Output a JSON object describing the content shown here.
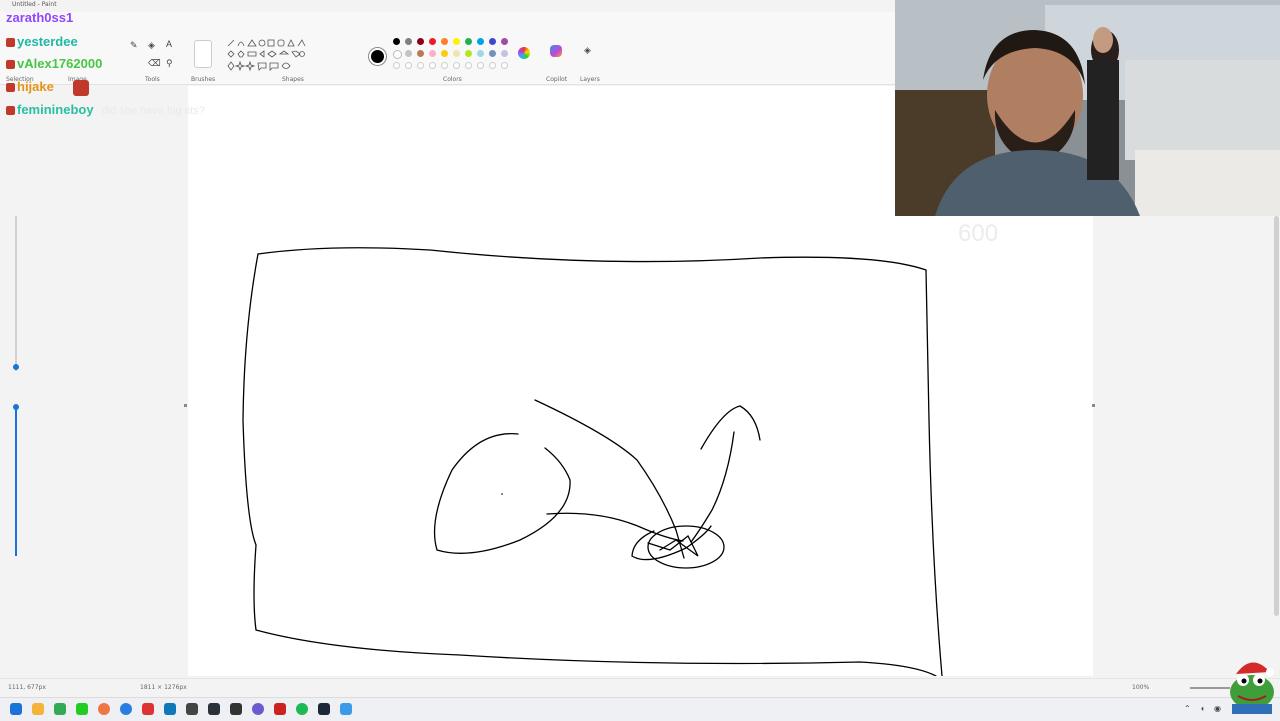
{
  "window": {
    "title": "Untitled - Paint"
  },
  "ribbon": {
    "groups": [
      {
        "label": "Selection"
      },
      {
        "label": "Image"
      },
      {
        "label": "Tools"
      },
      {
        "label": "Brushes"
      },
      {
        "label": "Shapes"
      },
      {
        "label": "Colors"
      },
      {
        "label": "Copilot"
      },
      {
        "label": "Layers"
      }
    ],
    "colors": [
      "#000000",
      "#7f7f7f",
      "#880015",
      "#ed1c24",
      "#ff7f27",
      "#fff200",
      "#22b14c",
      "#00a2e8",
      "#3f48cc",
      "#a349a4",
      "#ffffff",
      "#c3c3c3",
      "#b97a57",
      "#ffaec9",
      "#ffc90e",
      "#efe4b0",
      "#b5e61d",
      "#99d9ea",
      "#7092be",
      "#c8bfe7"
    ],
    "current_color": "#000000"
  },
  "chat": [
    {
      "user": "zarath0ss1",
      "color": "#9146ff",
      "message": ""
    },
    {
      "user": "yesterdee",
      "color": "#1fb8a5",
      "message": ""
    },
    {
      "user": "vAlex1762000",
      "color": "#44c743",
      "message": ""
    },
    {
      "user": "hijake",
      "color": "#e69317",
      "message": ""
    },
    {
      "user": "feminineboy",
      "color": "#28c0a0",
      "message": "did she have big tits?"
    }
  ],
  "overlay": {
    "text": "600"
  },
  "statusbar": {
    "cursor": "1111, 677px",
    "canvas_size": "1811 × 1276px",
    "zoom": "100%"
  }
}
